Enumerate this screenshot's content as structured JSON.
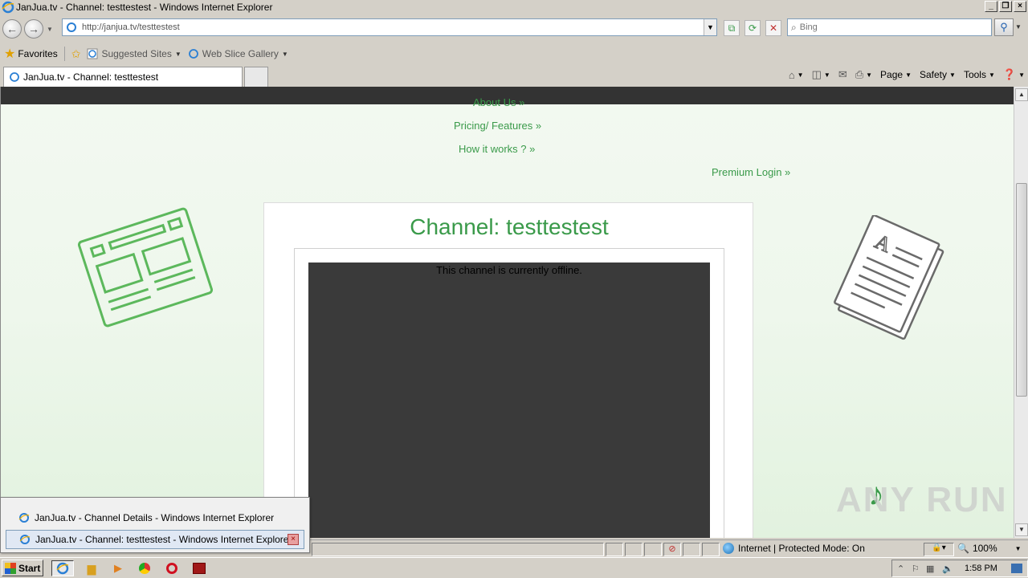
{
  "window": {
    "title": "JanJua.tv - Channel: testtestest - Windows Internet Explorer"
  },
  "address": {
    "url": "http://janjua.tv/testtestest",
    "search_placeholder": "Bing"
  },
  "favorites": {
    "label": "Favorites",
    "links": [
      "Suggested Sites",
      "Web Slice Gallery"
    ]
  },
  "tab": {
    "label": "JanJua.tv - Channel: testtestest"
  },
  "commandbar": {
    "page": "Page",
    "safety": "Safety",
    "tools": "Tools"
  },
  "site": {
    "nav": [
      "About Us »",
      "Pricing/ Features »",
      "How it works ? »"
    ],
    "premium_login": "Premium Login »",
    "channel_title": "Channel: testtestest",
    "offline_message": "This channel is currently offline."
  },
  "watermark": "ANY RUN",
  "statusbar": {
    "zone": "Internet | Protected Mode: On",
    "zoom": "100%"
  },
  "taskbar_popup": {
    "items": [
      "JanJua.tv - Channel Details - Windows Internet Explorer",
      "JanJua.tv - Channel: testtestest - Windows Internet Explorer"
    ]
  },
  "taskbar": {
    "start": "Start",
    "clock": "1:58 PM"
  },
  "colors": {
    "accent_green": "#3a9a4a",
    "player_bg": "#3a3a3a"
  }
}
